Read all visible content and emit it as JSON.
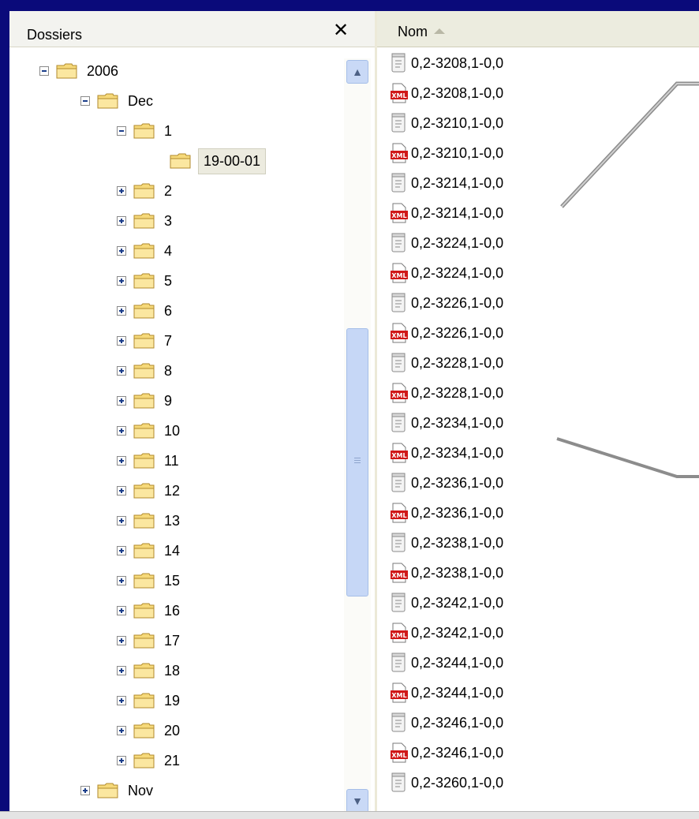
{
  "folders_panel": {
    "title": "Dossiers",
    "close_symbol": "✕",
    "tree": [
      {
        "label": "2006",
        "level": 0,
        "toggle": "minus"
      },
      {
        "label": "Dec",
        "level": 1,
        "toggle": "minus"
      },
      {
        "label": "1",
        "level": 2,
        "toggle": "minus"
      },
      {
        "label": "19-00-01",
        "level": 3,
        "toggle": "none",
        "selected": true
      },
      {
        "label": "2",
        "level": 2,
        "toggle": "plus"
      },
      {
        "label": "3",
        "level": 2,
        "toggle": "plus"
      },
      {
        "label": "4",
        "level": 2,
        "toggle": "plus"
      },
      {
        "label": "5",
        "level": 2,
        "toggle": "plus"
      },
      {
        "label": "6",
        "level": 2,
        "toggle": "plus"
      },
      {
        "label": "7",
        "level": 2,
        "toggle": "plus"
      },
      {
        "label": "8",
        "level": 2,
        "toggle": "plus"
      },
      {
        "label": "9",
        "level": 2,
        "toggle": "plus"
      },
      {
        "label": "10",
        "level": 2,
        "toggle": "plus"
      },
      {
        "label": "11",
        "level": 2,
        "toggle": "plus"
      },
      {
        "label": "12",
        "level": 2,
        "toggle": "plus"
      },
      {
        "label": "13",
        "level": 2,
        "toggle": "plus"
      },
      {
        "label": "14",
        "level": 2,
        "toggle": "plus"
      },
      {
        "label": "15",
        "level": 2,
        "toggle": "plus"
      },
      {
        "label": "16",
        "level": 2,
        "toggle": "plus"
      },
      {
        "label": "17",
        "level": 2,
        "toggle": "plus"
      },
      {
        "label": "18",
        "level": 2,
        "toggle": "plus"
      },
      {
        "label": "19",
        "level": 2,
        "toggle": "plus"
      },
      {
        "label": "20",
        "level": 2,
        "toggle": "plus"
      },
      {
        "label": "21",
        "level": 2,
        "toggle": "plus"
      },
      {
        "label": "Nov",
        "level": 1,
        "toggle": "plus"
      }
    ]
  },
  "files_panel": {
    "column_header": "Nom",
    "files": [
      {
        "name": "0,2-3208,1-0,0",
        "icon": "text-file-icon"
      },
      {
        "name": "0,2-3208,1-0,0",
        "icon": "xml-file-icon"
      },
      {
        "name": "0,2-3210,1-0,0",
        "icon": "text-file-icon"
      },
      {
        "name": "0,2-3210,1-0,0",
        "icon": "xml-file-icon"
      },
      {
        "name": "0,2-3214,1-0,0",
        "icon": "text-file-icon"
      },
      {
        "name": "0,2-3214,1-0,0",
        "icon": "xml-file-icon"
      },
      {
        "name": "0,2-3224,1-0,0",
        "icon": "text-file-icon"
      },
      {
        "name": "0,2-3224,1-0,0",
        "icon": "xml-file-icon"
      },
      {
        "name": "0,2-3226,1-0,0",
        "icon": "text-file-icon"
      },
      {
        "name": "0,2-3226,1-0,0",
        "icon": "xml-file-icon"
      },
      {
        "name": "0,2-3228,1-0,0",
        "icon": "text-file-icon"
      },
      {
        "name": "0,2-3228,1-0,0",
        "icon": "xml-file-icon"
      },
      {
        "name": "0,2-3234,1-0,0",
        "icon": "text-file-icon"
      },
      {
        "name": "0,2-3234,1-0,0",
        "icon": "xml-file-icon"
      },
      {
        "name": "0,2-3236,1-0,0",
        "icon": "text-file-icon"
      },
      {
        "name": "0,2-3236,1-0,0",
        "icon": "xml-file-icon"
      },
      {
        "name": "0,2-3238,1-0,0",
        "icon": "text-file-icon"
      },
      {
        "name": "0,2-3238,1-0,0",
        "icon": "xml-file-icon"
      },
      {
        "name": "0,2-3242,1-0,0",
        "icon": "text-file-icon"
      },
      {
        "name": "0,2-3242,1-0,0",
        "icon": "xml-file-icon"
      },
      {
        "name": "0,2-3244,1-0,0",
        "icon": "text-file-icon"
      },
      {
        "name": "0,2-3244,1-0,0",
        "icon": "xml-file-icon"
      },
      {
        "name": "0,2-3246,1-0,0",
        "icon": "text-file-icon"
      },
      {
        "name": "0,2-3246,1-0,0",
        "icon": "xml-file-icon"
      },
      {
        "name": "0,2-3260,1-0,0",
        "icon": "text-file-icon"
      }
    ]
  },
  "scrollbar": {
    "up_arrow": "▲",
    "down_arrow": "▼"
  },
  "colors": {
    "frame": "#0a0a7a",
    "folder": "#f6d97a",
    "xml_icon": "#d01818"
  }
}
